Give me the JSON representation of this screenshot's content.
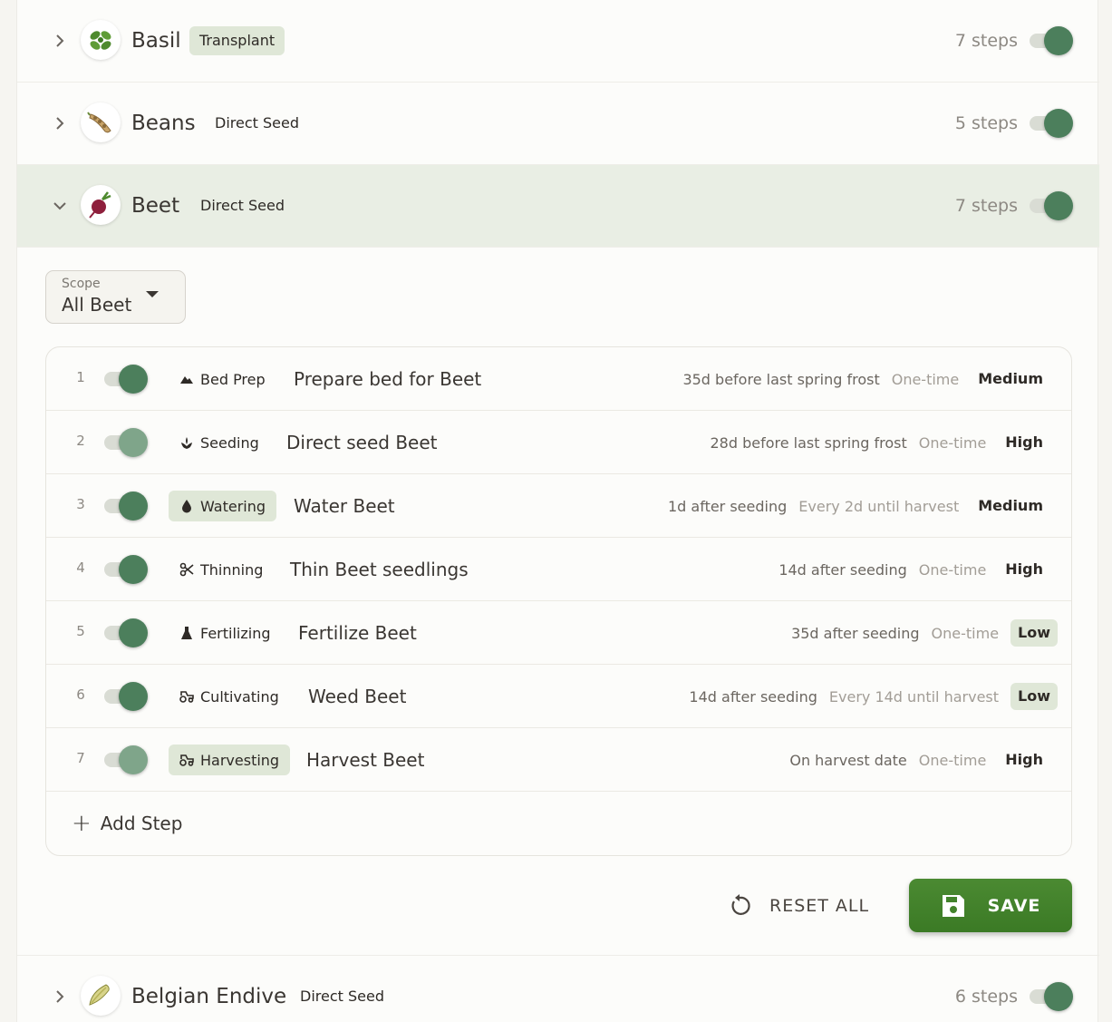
{
  "crops": [
    {
      "name": "Basil",
      "method": "Transplant",
      "steps": "7 steps"
    },
    {
      "name": "Beans",
      "method": "Direct Seed",
      "steps": "5 steps"
    },
    {
      "name": "Beet",
      "method": "Direct Seed",
      "steps": "7 steps"
    },
    {
      "name": "Belgian Endive",
      "method": "Direct Seed",
      "steps": "6 steps"
    }
  ],
  "scope": {
    "label": "Scope",
    "value": "All Beet"
  },
  "steps": [
    {
      "num": "1",
      "category": "Bed Prep",
      "category_icon": "mountain-icon",
      "title": "Prepare bed for Beet",
      "timing": "35d before last spring frost",
      "recurrence": "One-time",
      "priority": "Medium",
      "enabled": true
    },
    {
      "num": "2",
      "category": "Seeding",
      "category_icon": "sprout-icon",
      "title": "Direct seed Beet",
      "timing": "28d before last spring frost",
      "recurrence": "One-time",
      "priority": "High",
      "enabled": true
    },
    {
      "num": "3",
      "category": "Watering",
      "category_icon": "water-drop-icon",
      "title": "Water Beet",
      "timing": "1d after seeding",
      "recurrence": "Every 2d until harvest",
      "priority": "Medium",
      "enabled": true
    },
    {
      "num": "4",
      "category": "Thinning",
      "category_icon": "scissors-icon",
      "title": "Thin Beet seedlings",
      "timing": "14d after seeding",
      "recurrence": "One-time",
      "priority": "High",
      "enabled": true
    },
    {
      "num": "5",
      "category": "Fertilizing",
      "category_icon": "flask-icon",
      "title": "Fertilize Beet",
      "timing": "35d after seeding",
      "recurrence": "One-time",
      "priority": "Low",
      "enabled": true
    },
    {
      "num": "6",
      "category": "Cultivating",
      "category_icon": "tractor-icon",
      "title": "Weed Beet",
      "timing": "14d after seeding",
      "recurrence": "Every 14d until harvest",
      "priority": "Low",
      "enabled": true
    },
    {
      "num": "7",
      "category": "Harvesting",
      "category_icon": "tractor-icon",
      "title": "Harvest Beet",
      "timing": "On harvest date",
      "recurrence": "One-time",
      "priority": "High",
      "enabled": true
    }
  ],
  "add_step_label": "Add Step",
  "actions": {
    "reset_label": "RESET ALL",
    "save_label": "SAVE"
  },
  "colors": {
    "accent": "#3b7a25",
    "switch_on": "#4c7f5c",
    "tag_bg": "#dfe7d7",
    "expanded_bg": "#e9eee4"
  }
}
